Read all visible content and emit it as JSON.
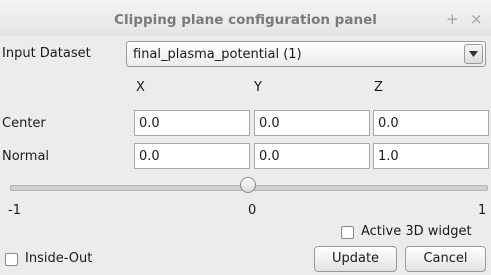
{
  "window": {
    "title": "Clipping plane configuration panel",
    "float_glyph": "+",
    "close_glyph": "×"
  },
  "dataset": {
    "label": "Input Dataset",
    "selected": "final_plasma_potential (1)"
  },
  "columns": [
    "X",
    "Y",
    "Z"
  ],
  "rows": [
    {
      "label": "Center",
      "values": [
        "0.0",
        "0.0",
        "0.0"
      ]
    },
    {
      "label": "Normal",
      "values": [
        "0.0",
        "0.0",
        "1.0"
      ]
    }
  ],
  "slider": {
    "min_label": "-1",
    "mid_label": "0",
    "max_label": "1",
    "value": 0,
    "min": -1,
    "max": 1
  },
  "options": {
    "active_widget": {
      "label": "Active 3D widget",
      "checked": false
    },
    "inside_out": {
      "label": "Inside-Out",
      "checked": false
    }
  },
  "buttons": {
    "update": "Update",
    "cancel": "Cancel"
  },
  "icons": {
    "float": "float-icon",
    "close": "close-icon",
    "dropdown": "chevron-down-icon"
  }
}
